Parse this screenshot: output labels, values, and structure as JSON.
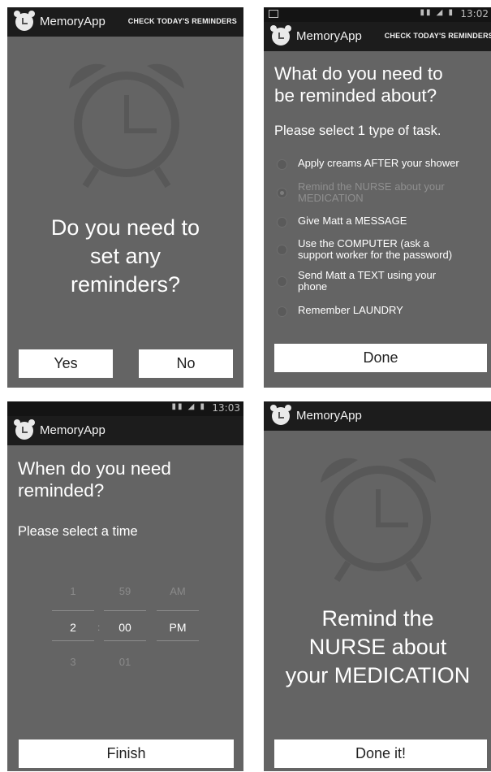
{
  "app": {
    "title": "MemoryApp",
    "action": "CHECK TODAY'S REMINDERS"
  },
  "screen1": {
    "question": [
      "Do you need to",
      "set any",
      "reminders?"
    ],
    "yes_label": "Yes",
    "no_label": "No"
  },
  "screen2": {
    "status_time": "13:02",
    "heading": [
      "What do you need to",
      "be reminded about?"
    ],
    "subheading": "Please select 1 type of task.",
    "options": [
      [
        "Apply creams AFTER your shower"
      ],
      [
        "Remind the NURSE about your",
        "MEDICATION"
      ],
      [
        "Give Matt a MESSAGE"
      ],
      [
        "Use the COMPUTER (ask a",
        "support worker for the password)"
      ],
      [
        "Send Matt a TEXT using your",
        "phone"
      ],
      [
        "Remember LAUNDRY"
      ]
    ],
    "done_label": "Done"
  },
  "screen3": {
    "status_time": "13:03",
    "heading": [
      "When do you need",
      "reminded?"
    ],
    "subheading": "Please select a time",
    "picker": {
      "hour": {
        "prev": "1",
        "selected": "2",
        "next": "3"
      },
      "minute": {
        "prev": "59",
        "selected": "00",
        "next": "01"
      },
      "ampm": {
        "prev": "AM",
        "selected": "PM"
      },
      "separator": ":"
    },
    "finish_label": "Finish"
  },
  "screen4": {
    "message": [
      "Remind the",
      "NURSE about",
      "your MEDICATION"
    ],
    "done_label": "Done it!"
  },
  "colors": {
    "panel_bg": "#646464",
    "bar_bg": "#1c1c1c",
    "button_bg": "#ffffff",
    "text": "#ffffff"
  },
  "icons": [
    "alarm-clock-icon",
    "app-logo-icon",
    "signal-icon",
    "battery-icon",
    "image-icon"
  ]
}
